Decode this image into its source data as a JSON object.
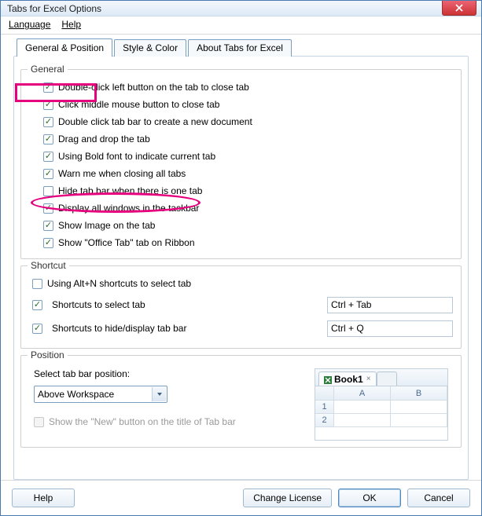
{
  "window": {
    "title": "Tabs for Excel Options"
  },
  "menu": {
    "language": "Language",
    "help": "Help"
  },
  "tabs": {
    "general": "General & Position",
    "style": "Style & Color",
    "about": "About Tabs for Excel"
  },
  "general_group": {
    "title": "General",
    "items": [
      {
        "checked": true,
        "label": "Double-click left button on the tab to close tab"
      },
      {
        "checked": true,
        "label": "Click middle mouse button to close tab"
      },
      {
        "checked": true,
        "label": "Double click tab bar to create a new document"
      },
      {
        "checked": true,
        "label": "Drag and drop the tab"
      },
      {
        "checked": true,
        "label": "Using Bold font to indicate current tab"
      },
      {
        "checked": true,
        "label": "Warn me when closing all tabs"
      },
      {
        "checked": false,
        "label": "Hide tab bar when there is one tab"
      },
      {
        "checked": true,
        "label": "Display all windows in the taskbar"
      },
      {
        "checked": true,
        "label": "Show Image on the tab"
      },
      {
        "checked": true,
        "label": "Show \"Office Tab\" tab on Ribbon"
      }
    ]
  },
  "shortcut_group": {
    "title": "Shortcut",
    "alt_n": {
      "checked": false,
      "label": "Using Alt+N shortcuts to select tab"
    },
    "select_tab": {
      "checked": true,
      "label": "Shortcuts to select tab",
      "value": "Ctrl + Tab"
    },
    "toggle_bar": {
      "checked": true,
      "label": "Shortcuts to hide/display tab bar",
      "value": "Ctrl + Q"
    }
  },
  "position_group": {
    "title": "Position",
    "label": "Select tab bar position:",
    "value": "Above Workspace",
    "show_new": {
      "checked": false,
      "label": "Show the \"New\" button on the title of Tab bar",
      "disabled": true
    },
    "preview": {
      "book": "Book1",
      "colA": "A",
      "colB": "B",
      "row1": "1",
      "row2": "2"
    }
  },
  "footer": {
    "help": "Help",
    "change": "Change License",
    "ok": "OK",
    "cancel": "Cancel"
  }
}
